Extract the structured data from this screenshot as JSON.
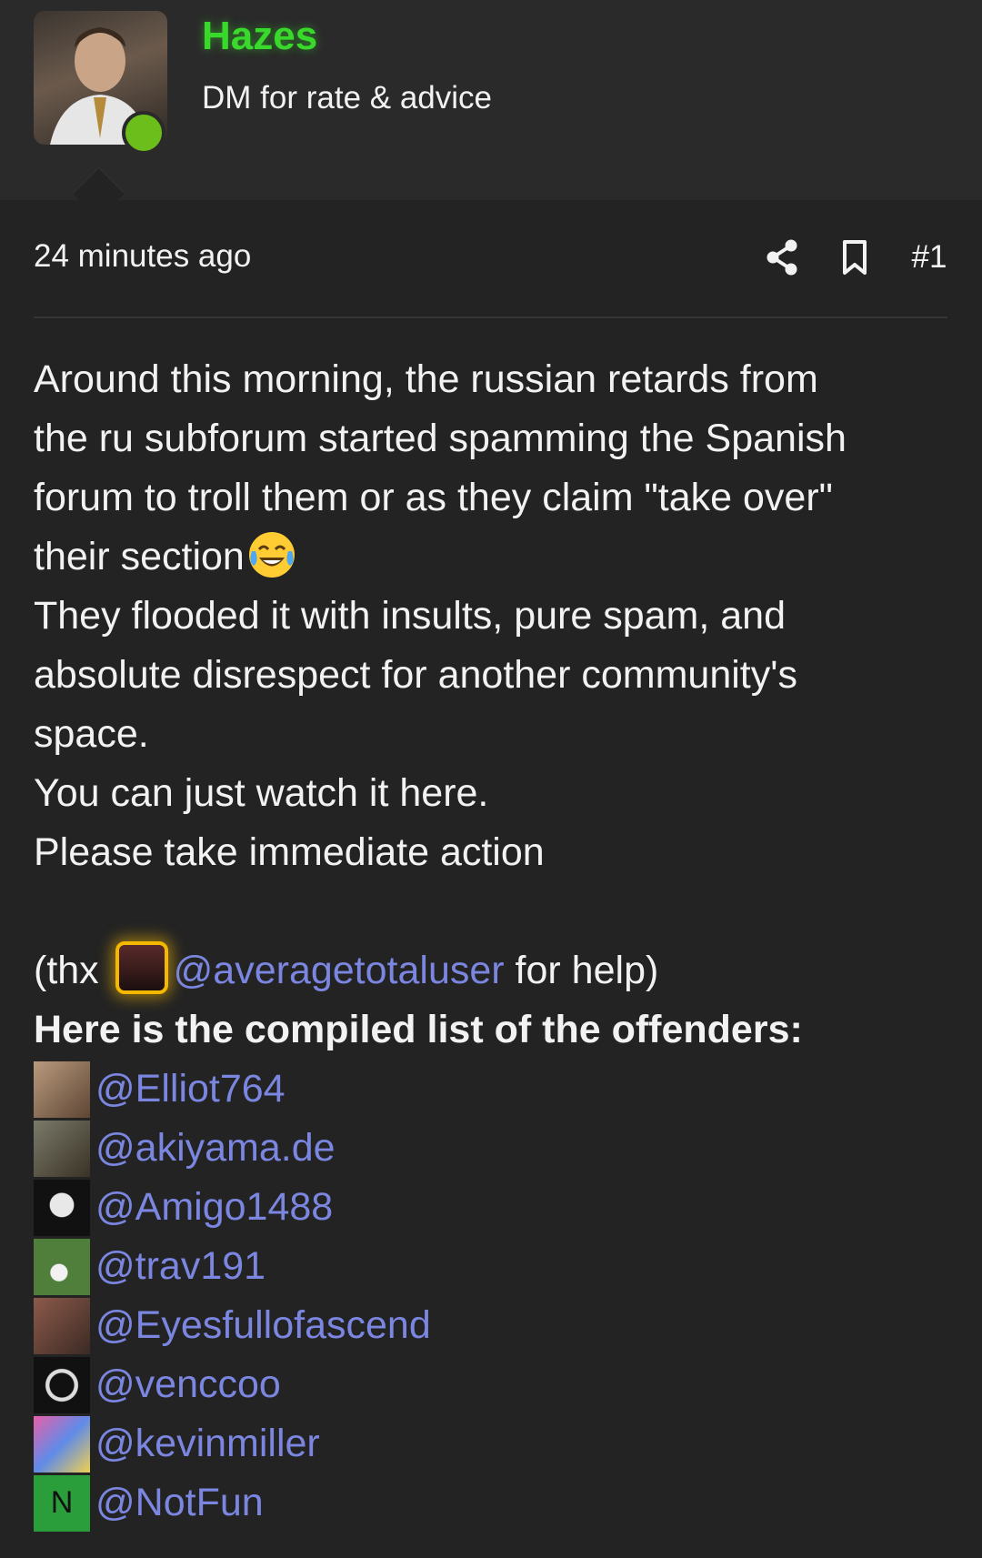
{
  "author": {
    "name": "Hazes",
    "tagline": "DM for rate & advice",
    "status": "online",
    "status_color": "#6cbf1a",
    "name_color": "#39d92c"
  },
  "post": {
    "time": "24 minutes ago",
    "number": "#1",
    "actions": [
      "share-icon",
      "bookmark-icon"
    ],
    "lines": [
      "Around this morning, the russian retards from",
      "the ru subforum started spamming the Spanish",
      "forum to troll them or as they claim \"take over\"",
      "their section",
      "They flooded it with insults, pure spam, and",
      "absolute disrespect for another community's",
      "space.",
      "You can just watch it here.",
      "Please take immediate action"
    ],
    "thanks_prefix": "(thx ",
    "thanks_mention": "@averagetotaluser",
    "thanks_suffix": " for help)",
    "list_heading": "Here is the compiled list of the offenders:",
    "offenders": [
      "@Elliot764",
      "@akiyama.de",
      "@Amigo1488",
      "@trav191",
      "@Eyesfullofascend",
      "@venccoo",
      "@kevinmiller",
      "@NotFun"
    ],
    "notfun_avatar_letter": "N"
  },
  "colors": {
    "background": "#232323",
    "header": "#2a2a2a",
    "mention": "#7b86e0",
    "highlight": "#f5b800"
  }
}
